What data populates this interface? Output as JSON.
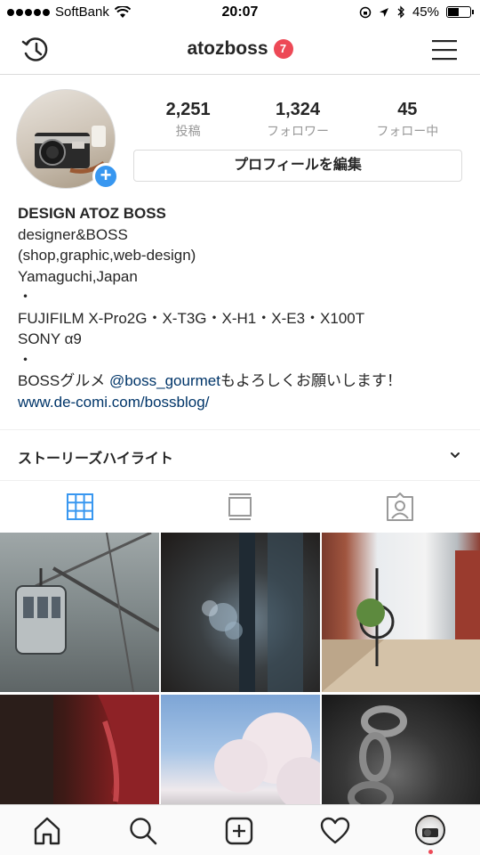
{
  "status": {
    "carrier": "SoftBank",
    "time": "20:07",
    "battery": "45%",
    "battery_level": 0.45
  },
  "header": {
    "username": "atozboss",
    "notification_count": "7"
  },
  "profile": {
    "stats": [
      {
        "value": "2,251",
        "label": "投稿"
      },
      {
        "value": "1,324",
        "label": "フォロワー"
      },
      {
        "value": "45",
        "label": "フォロー中"
      }
    ],
    "edit_label": "プロフィールを編集",
    "name": "DESIGN ATOZ BOSS",
    "bio_lines": [
      "designer&BOSS",
      "(shop,graphic,web-design)",
      "Yamaguchi,Japan",
      "・",
      "FUJIFILM X-Pro2G・X-T3G・X-H1・X-E3・X100T",
      "SONY α9",
      "・"
    ],
    "gourmet_prefix": "BOSSグルメ ",
    "gourmet_mention": "@boss_gourmet",
    "gourmet_suffix": "もよろしくお願いします！",
    "website": "www.de-comi.com/bossblog/"
  },
  "highlights": {
    "label": "ストーリーズハイライト"
  },
  "icons": {
    "history": "history-icon",
    "menu": "menu-icon",
    "grid": "grid-icon",
    "feed": "feed-icon",
    "tagged": "tagged-icon",
    "home": "home-icon",
    "search": "search-icon",
    "add": "add-post-icon",
    "activity": "heart-icon",
    "profile": "profile-avatar-icon"
  },
  "colors": {
    "accent": "#3897f0",
    "badge": "#ed4956",
    "link": "#003569"
  }
}
